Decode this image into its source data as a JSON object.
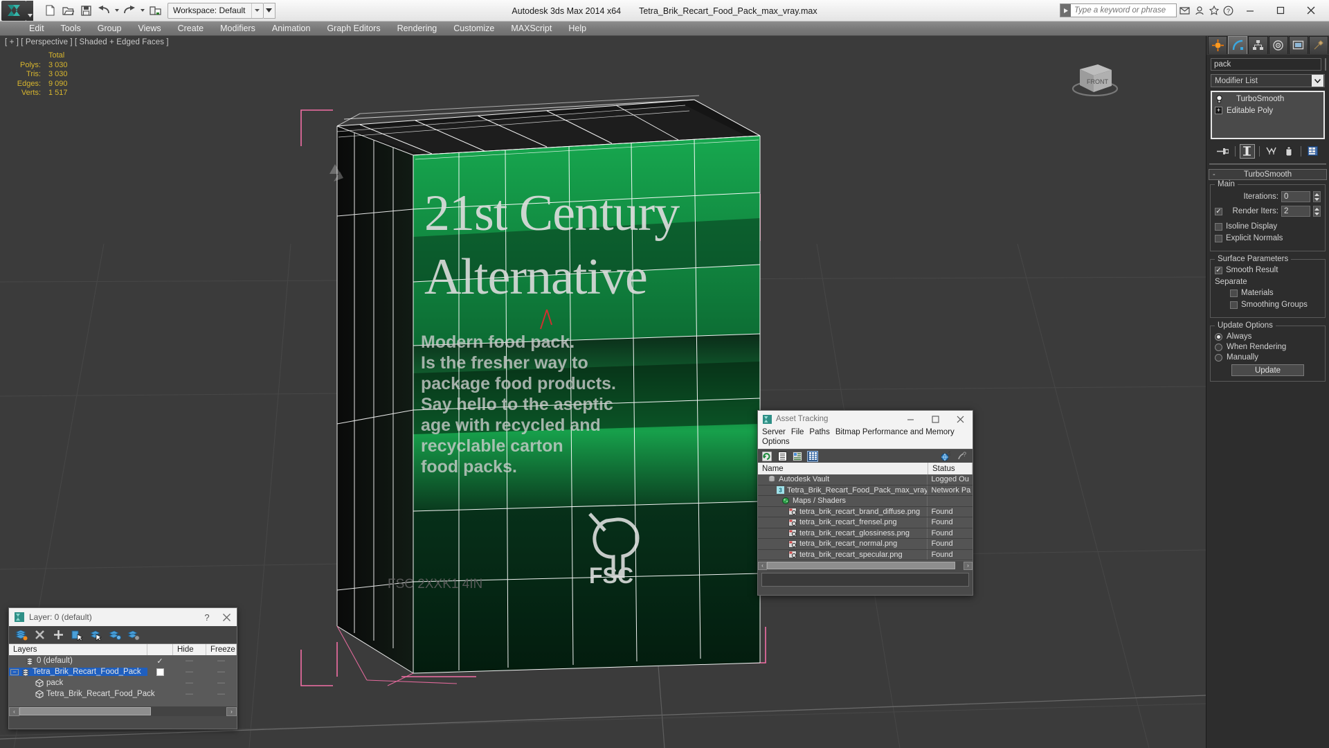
{
  "titlebar": {
    "app_title": "Autodesk 3ds Max  2014 x64",
    "file_title": "Tetra_Brik_Recart_Food_Pack_max_vray.max",
    "workspace_label": "Workspace: Default",
    "search_placeholder": "Type a keyword or phrase",
    "qat": [
      {
        "name": "new-file-icon",
        "label": "New"
      },
      {
        "name": "open-file-icon",
        "label": "Open"
      },
      {
        "name": "save-file-icon",
        "label": "Save"
      },
      {
        "name": "undo-icon",
        "label": "Undo"
      },
      {
        "name": "redo-icon",
        "label": "Redo"
      },
      {
        "name": "project-folder-icon",
        "label": "Set Project Folder"
      }
    ],
    "window_controls": {
      "minimize": "—",
      "maximize": "□",
      "close": "✕"
    }
  },
  "menubar": {
    "items": [
      "Edit",
      "Tools",
      "Group",
      "Views",
      "Create",
      "Modifiers",
      "Animation",
      "Graph Editors",
      "Rendering",
      "Customize",
      "MAXScript",
      "Help"
    ]
  },
  "viewport": {
    "label": "[ + ] [ Perspective ] [ Shaded + Edged Faces ]",
    "stats": {
      "header": "Total",
      "rows": [
        {
          "label": "Polys:",
          "value": "3 030"
        },
        {
          "label": "Tris:",
          "value": "3 030"
        },
        {
          "label": "Edges:",
          "value": "9 090"
        },
        {
          "label": "Verts:",
          "value": "1 517"
        }
      ]
    },
    "viewcube_label": "FRONT",
    "package": {
      "headline_line1": "21st Century",
      "headline_line2": "Alternative",
      "body_lines": [
        "Modern food pack.",
        "Is the fresher way to",
        "package food products.",
        "Say hello to the aseptic",
        "age with recycled and",
        "recyclable carton",
        "food packs."
      ],
      "fsc_label": "FSC",
      "bottom_code": "FSC 2XXK1 4IN"
    },
    "colors": {
      "background": "#3b3b3b",
      "stats_text": "#d8b62e",
      "gizmo_pink": "#f06fa0",
      "wire_white": "#ffffff",
      "pack_green_light": "#14a04a",
      "pack_green_dark": "#062d18"
    }
  },
  "command_panel": {
    "tabs": [
      {
        "name": "create-tab",
        "label": "Create"
      },
      {
        "name": "modify-tab",
        "label": "Modify",
        "active": true
      },
      {
        "name": "hierarchy-tab",
        "label": "Hierarchy"
      },
      {
        "name": "motion-tab",
        "label": "Motion"
      },
      {
        "name": "display-tab",
        "label": "Display"
      },
      {
        "name": "utilities-tab",
        "label": "Utilities"
      }
    ],
    "object_name": "pack",
    "object_color": "#57c6d4",
    "modifier_list_label": "Modifier List",
    "modifier_stack": [
      {
        "label": "TurboSmooth",
        "icon": "lightbulb-icon"
      },
      {
        "label": "Editable Poly",
        "icon": "expand-plus-icon"
      }
    ],
    "stack_tools": [
      {
        "name": "pin-stack-icon"
      },
      {
        "name": "show-end-result-icon"
      },
      {
        "name": "make-unique-icon"
      },
      {
        "name": "remove-modifier-icon"
      },
      {
        "name": "configure-modifier-sets-icon"
      }
    ],
    "rollout": {
      "title": "TurboSmooth",
      "collapse_glyph": "-",
      "main": {
        "title": "Main",
        "iterations_label": "Iterations:",
        "iterations_value": "0",
        "render_iters_label": "Render Iters:",
        "render_iters_value": "2",
        "render_iters_checked": true,
        "isoline_display_label": "Isoline Display",
        "isoline_display_checked": false,
        "explicit_normals_label": "Explicit Normals",
        "explicit_normals_checked": false
      },
      "surface_parameters": {
        "title": "Surface Parameters",
        "smooth_result_label": "Smooth Result",
        "smooth_result_checked": true,
        "separate_label": "Separate",
        "materials_label": "Materials",
        "materials_checked": false,
        "smoothing_groups_label": "Smoothing Groups",
        "smoothing_groups_checked": false
      },
      "update_options": {
        "title": "Update Options",
        "options": [
          {
            "label": "Always",
            "selected": true
          },
          {
            "label": "When Rendering",
            "selected": false
          },
          {
            "label": "Manually",
            "selected": false
          }
        ],
        "update_button": "Update"
      }
    }
  },
  "layer_dialog": {
    "title": "Layer: 0 (default)",
    "help_glyph": "?",
    "close_glyph": "✕",
    "toolbar": [
      {
        "name": "new-layer-icon"
      },
      {
        "name": "delete-layer-icon"
      },
      {
        "name": "add-layer-icon"
      },
      {
        "name": "select-objects-in-layer-icon"
      },
      {
        "name": "highlight-selected-objects-icon"
      },
      {
        "name": "layer-properties-icon"
      },
      {
        "name": "layer-settings-icon"
      }
    ],
    "columns": [
      "Layers",
      "",
      "Hide",
      "Freeze"
    ],
    "rows": [
      {
        "name": "0 (default)",
        "indent": 1,
        "current": "✓",
        "hide": "—",
        "freeze": "—",
        "selected": false,
        "expander": ""
      },
      {
        "name": "Tetra_Brik_Recart_Food_Pack",
        "indent": 0,
        "current": "",
        "hide": "—",
        "freeze": "—",
        "selected": true,
        "expander": "−"
      },
      {
        "name": "pack",
        "indent": 2,
        "current": "",
        "hide": "—",
        "freeze": "—",
        "selected": false,
        "expander": ""
      },
      {
        "name": "Tetra_Brik_Recart_Food_Pack",
        "indent": 2,
        "current": "",
        "hide": "—",
        "freeze": "—",
        "selected": false,
        "expander": ""
      }
    ],
    "scroll_left": "‹",
    "scroll_right": "›"
  },
  "asset_tracking": {
    "title": "Asset Tracking",
    "window_controls": {
      "minimize": "—",
      "maximize": "□",
      "close": "✕"
    },
    "menus": [
      "Server",
      "File",
      "Paths",
      "Bitmap Performance and Memory",
      "Options"
    ],
    "toolbar": [
      {
        "name": "refresh-icon",
        "selected": false
      },
      {
        "name": "list-view-icon",
        "selected": false
      },
      {
        "name": "detail-view-icon",
        "selected": false
      },
      {
        "name": "grid-view-icon",
        "selected": true
      }
    ],
    "toolbar_right": [
      {
        "name": "help-globe-icon"
      },
      {
        "name": "help-icon"
      }
    ],
    "columns": [
      "Name",
      "Status"
    ],
    "rows": [
      {
        "name": "Autodesk Vault",
        "status": "Logged Ou",
        "indent": 1,
        "icon": "vault-icon"
      },
      {
        "name": "Tetra_Brik_Recart_Food_Pack_max_vray.max",
        "status": "Network Pa",
        "indent": 2,
        "icon": "max-file-icon"
      },
      {
        "name": "Maps / Shaders",
        "status": "",
        "indent": 3,
        "icon": "maps-shaders-icon"
      },
      {
        "name": "tetra_brik_recart_brand_diffuse.png",
        "status": "Found",
        "indent": 4,
        "icon": "bitmap-icon"
      },
      {
        "name": "tetra_brik_recart_frensel.png",
        "status": "Found",
        "indent": 4,
        "icon": "bitmap-icon"
      },
      {
        "name": "tetra_brik_recart_glossiness.png",
        "status": "Found",
        "indent": 4,
        "icon": "bitmap-icon"
      },
      {
        "name": "tetra_brik_recart_normal.png",
        "status": "Found",
        "indent": 4,
        "icon": "bitmap-icon"
      },
      {
        "name": "tetra_brik_recart_specular.png",
        "status": "Found",
        "indent": 4,
        "icon": "bitmap-icon"
      }
    ],
    "scroll_left": "‹",
    "scroll_right": "›"
  }
}
